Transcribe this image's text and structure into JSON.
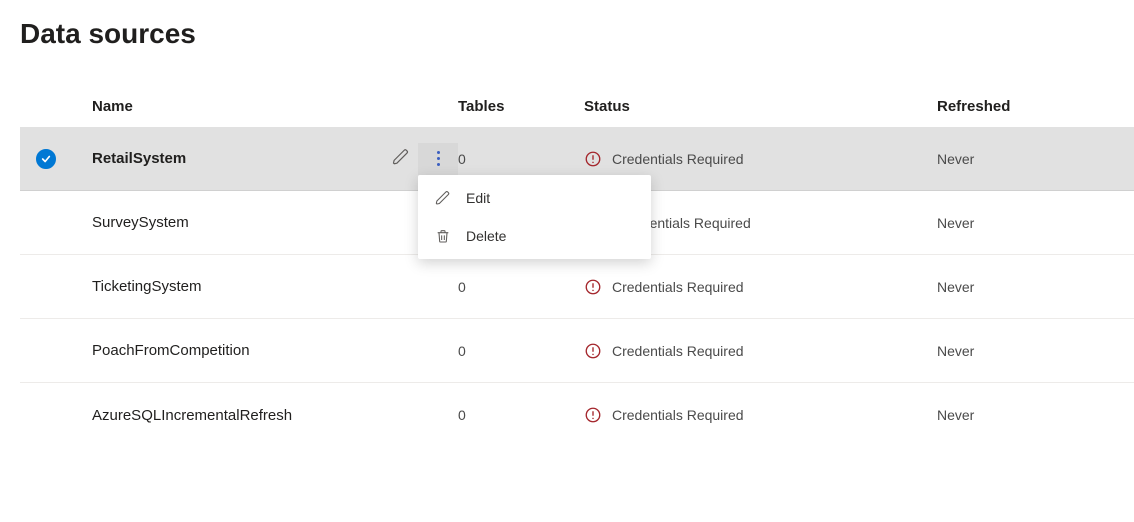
{
  "page_title": "Data sources",
  "columns": {
    "name": "Name",
    "tables": "Tables",
    "status": "Status",
    "refreshed": "Refreshed"
  },
  "rows": [
    {
      "name": "RetailSystem",
      "tables": "0",
      "status": "Credentials Required",
      "refreshed": "Never",
      "selected": true
    },
    {
      "name": "SurveySystem",
      "tables": "",
      "status_suffix": "edentials Required",
      "refreshed": "Never",
      "selected": false
    },
    {
      "name": "TicketingSystem",
      "tables": "0",
      "status": "Credentials Required",
      "refreshed": "Never",
      "selected": false
    },
    {
      "name": "PoachFromCompetition",
      "tables": "0",
      "status": "Credentials Required",
      "refreshed": "Never",
      "selected": false
    },
    {
      "name": "AzureSQLIncrementalRefresh",
      "tables": "0",
      "status": "Credentials Required",
      "refreshed": "Never",
      "selected": false
    }
  ],
  "context_menu": {
    "edit": "Edit",
    "delete": "Delete"
  }
}
